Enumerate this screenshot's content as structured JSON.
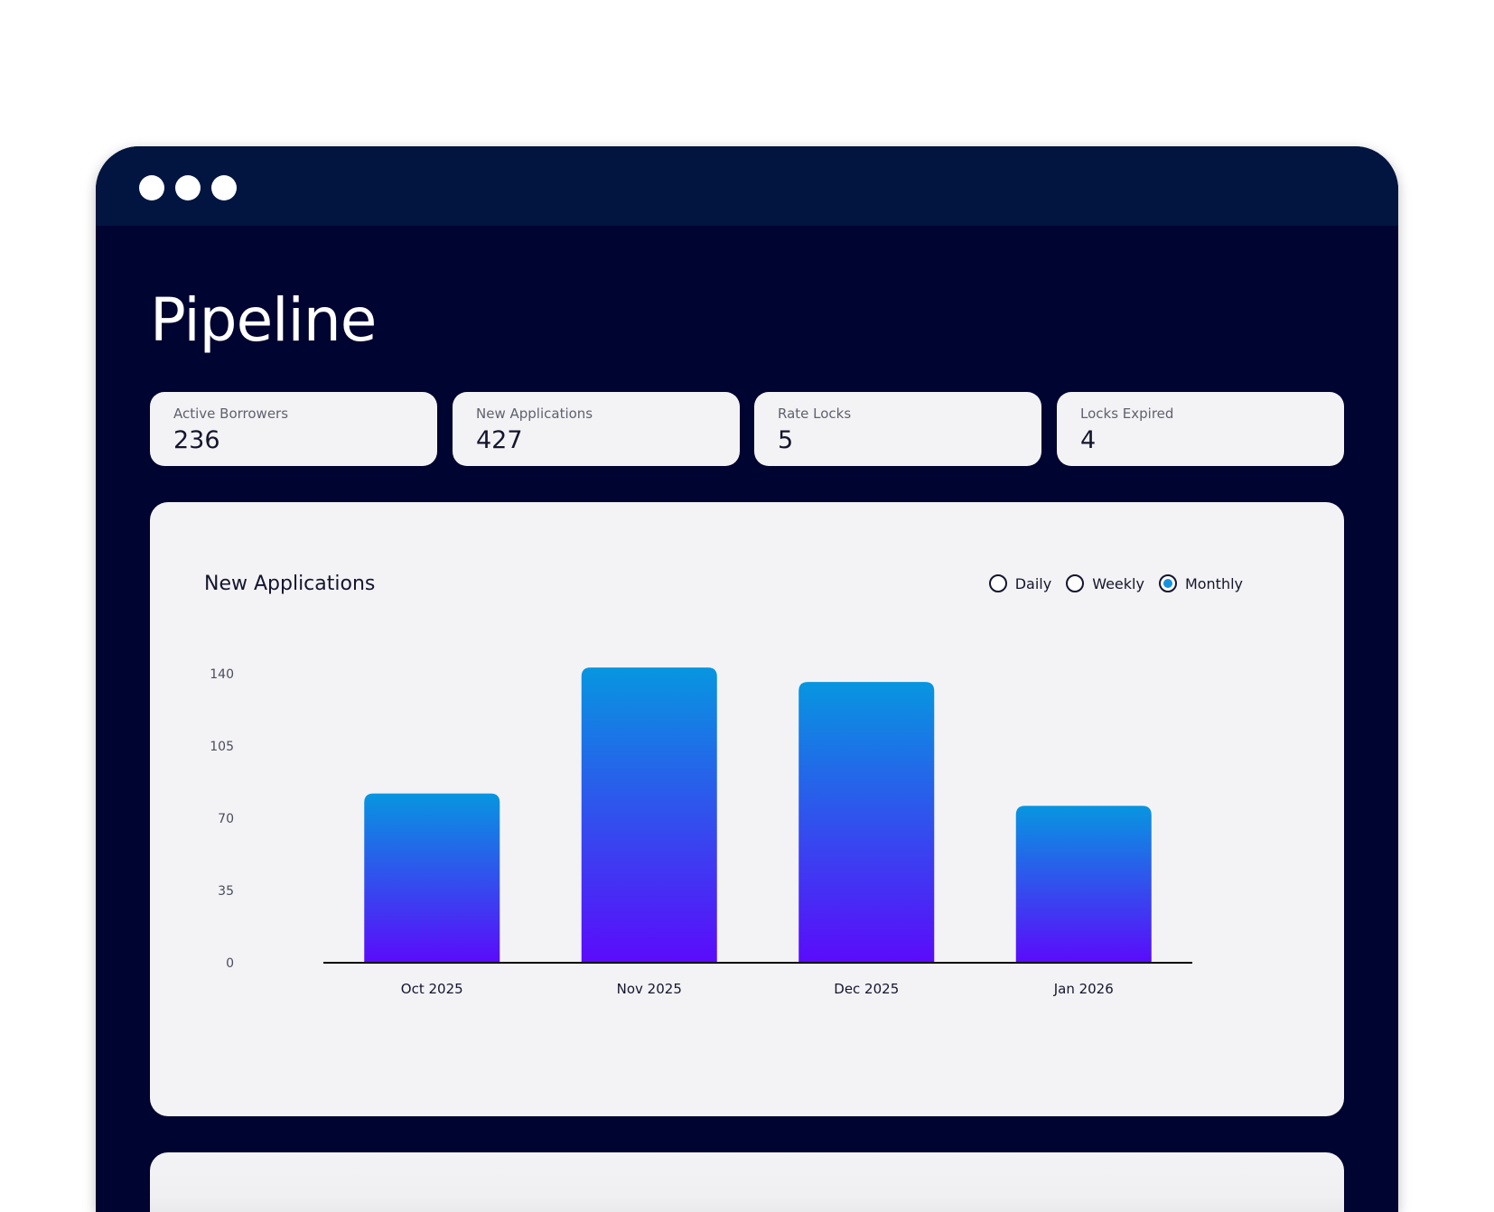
{
  "page": {
    "title": "Pipeline"
  },
  "stats": [
    {
      "label": "Active Borrowers",
      "value": "236"
    },
    {
      "label": "New Applications",
      "value": "427"
    },
    {
      "label": "Rate Locks",
      "value": "5"
    },
    {
      "label": "Locks Expired",
      "value": "4"
    }
  ],
  "chart_panel": {
    "title": "New Applications",
    "period_options": [
      {
        "label": "Daily",
        "selected": false
      },
      {
        "label": "Weekly",
        "selected": false
      },
      {
        "label": "Monthly",
        "selected": true
      }
    ]
  },
  "colors": {
    "window_bg": "#000430",
    "titlebar_bg": "#011540",
    "card_bg": "#f3f3f5",
    "bar_gradient_top": "#0796e0",
    "bar_gradient_bottom": "#5b0bfb",
    "radio_selected": "#1792e0"
  },
  "chart_data": {
    "type": "bar",
    "categories": [
      "Oct 2025",
      "Nov 2025",
      "Dec 2025",
      "Jan 2026"
    ],
    "values": [
      82,
      143,
      136,
      76
    ],
    "title": "New Applications",
    "xlabel": "",
    "ylabel": "",
    "ylim": [
      0,
      140
    ],
    "yticks": [
      0,
      35,
      70,
      105,
      140
    ],
    "grid": false,
    "legend": "none"
  }
}
